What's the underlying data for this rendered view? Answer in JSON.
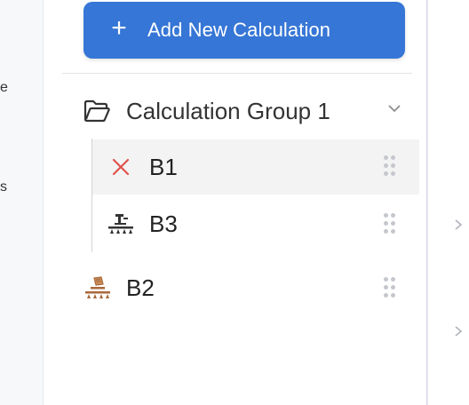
{
  "left_strip": {
    "fragments": [
      "e",
      "s"
    ]
  },
  "add_button": {
    "label": "Add New Calculation"
  },
  "group": {
    "title": "Calculation Group 1",
    "icon": "folder-open-icon",
    "expanded": true
  },
  "group_items": [
    {
      "name": "B1",
      "icon": "error-x-icon",
      "selected": true,
      "accent": "#e0524f"
    },
    {
      "name": "B3",
      "icon": "machine-icon",
      "selected": false
    }
  ],
  "ungrouped_items": [
    {
      "name": "B2",
      "icon": "machine-paper-icon",
      "accent": "#a9683a"
    }
  ],
  "colors": {
    "primary": "#3676d6",
    "selected_bg": "#f3f3f3",
    "drag_handle": "#c4c7cc"
  }
}
